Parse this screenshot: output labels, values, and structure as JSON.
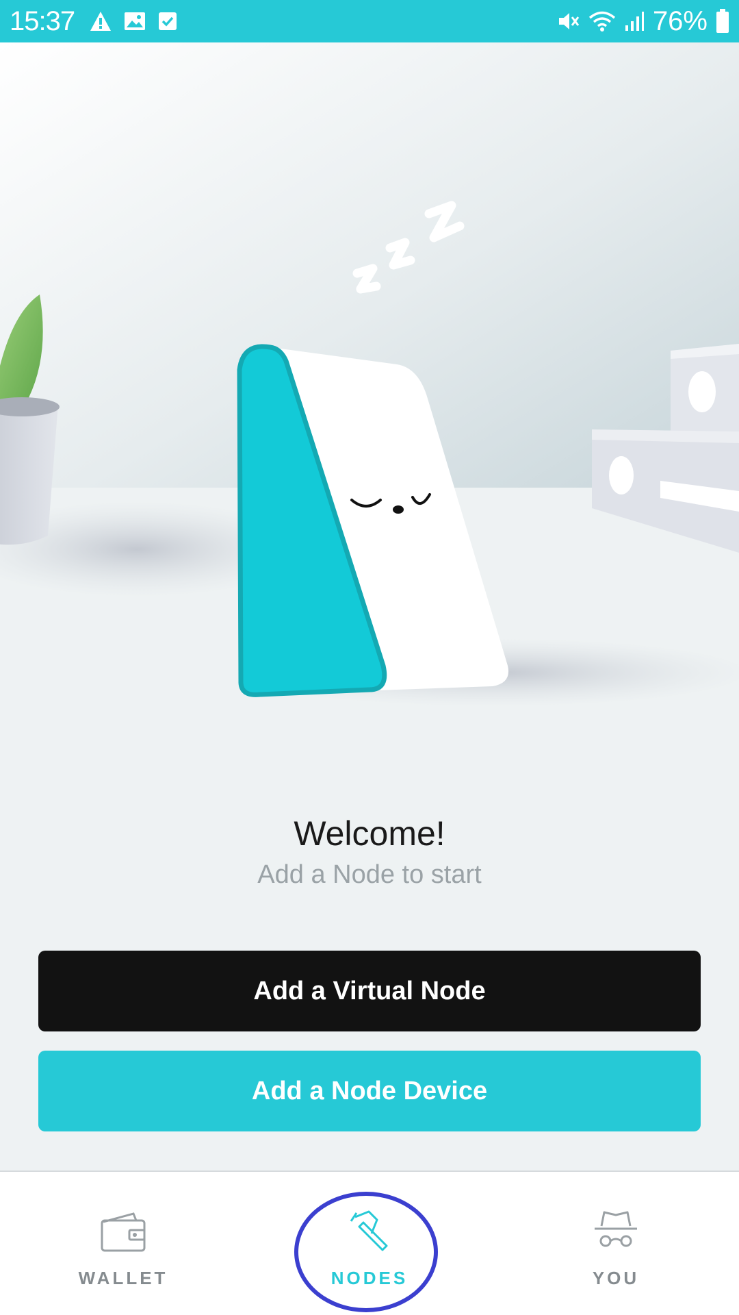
{
  "status_bar": {
    "time": "15:37",
    "left_icons": [
      "warning-icon",
      "image-icon",
      "checkbox-icon"
    ],
    "right_icons": [
      "mute-icon",
      "wifi-icon",
      "signal-icon",
      "battery-icon"
    ],
    "battery": "76%",
    "battery_level": 0.76
  },
  "welcome": {
    "title": "Welcome!",
    "subtitle": "Add a Node to start"
  },
  "buttons": {
    "add_virtual": "Add a Virtual Node",
    "add_device": "Add a Node Device"
  },
  "nav": {
    "items": [
      {
        "label": "WALLET",
        "icon": "wallet-icon",
        "active": false
      },
      {
        "label": "NODES",
        "icon": "pickaxe-icon",
        "active": true
      },
      {
        "label": "YOU",
        "icon": "incognito-icon",
        "active": false
      }
    ]
  },
  "colors": {
    "accent": "#26c9d6",
    "dark_button": "#121212",
    "highlight_ring": "#3b3fcf"
  }
}
